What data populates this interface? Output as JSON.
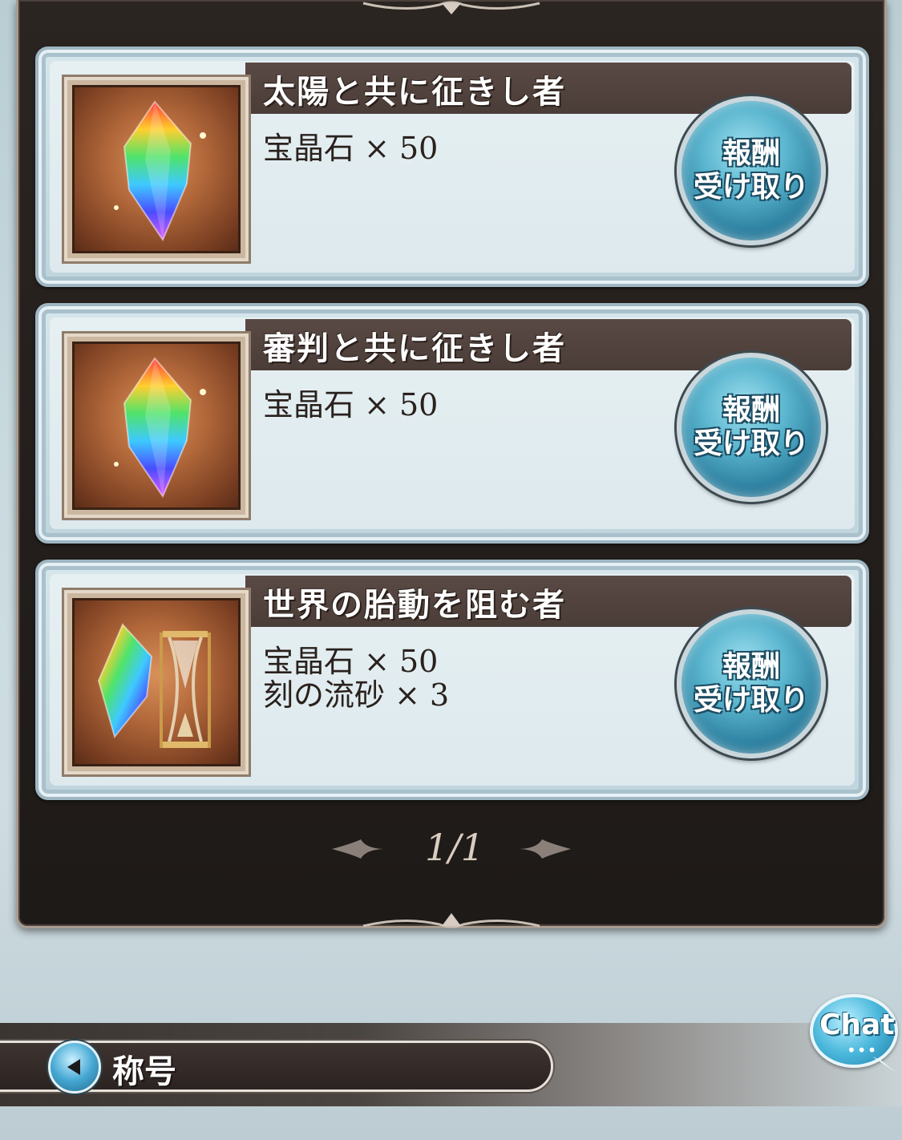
{
  "rewards": [
    {
      "title": "太陽と共に征きし者",
      "lines": [
        "宝晶石 × 50"
      ],
      "button": [
        "報酬",
        "受け取り"
      ],
      "item": "crystal"
    },
    {
      "title": "審判と共に征きし者",
      "lines": [
        "宝晶石 × 50"
      ],
      "button": [
        "報酬",
        "受け取り"
      ],
      "item": "crystal"
    },
    {
      "title": "世界の胎動を阻む者",
      "lines": [
        "宝晶石 × 50",
        "刻の流砂 × 3"
      ],
      "button": [
        "報酬",
        "受け取り"
      ],
      "item": "crystal-hourglass"
    }
  ],
  "pager": {
    "text": "1/1"
  },
  "nav": {
    "back_label": "称号"
  },
  "chat": {
    "label": "Chat",
    "dots": "•••"
  },
  "colors": {
    "header": "#4a3c37",
    "card": "#d6e6ec",
    "button": "#2c7f9f"
  }
}
